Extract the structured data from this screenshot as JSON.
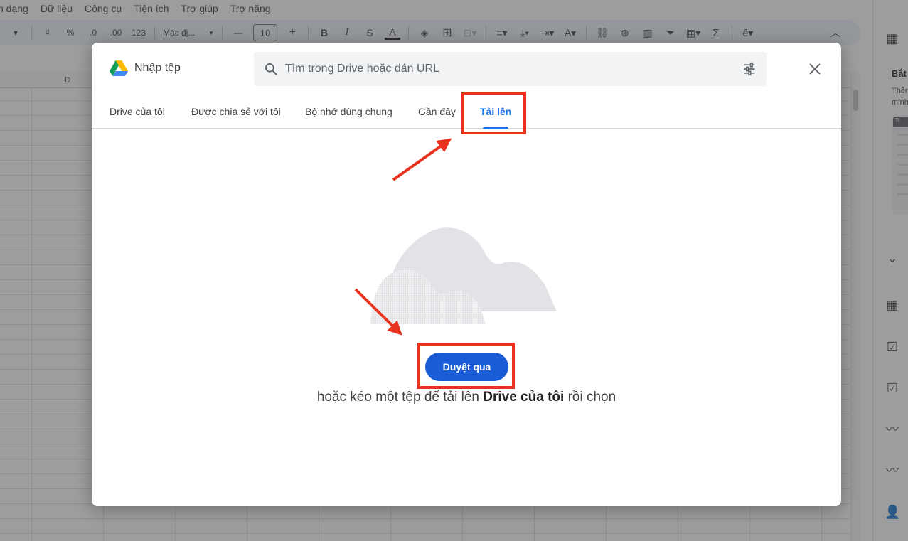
{
  "menubar": [
    "n dạng",
    "Dữ liệu",
    "Công cụ",
    "Tiện ích",
    "Trợ giúp",
    "Trợ năng"
  ],
  "toolbar": {
    "currency": "₫",
    "percent": "%",
    "dec_decrease": ".0",
    "dec_increase": ".00",
    "number_format": "123",
    "font": "Mặc đị...",
    "font_size": "10"
  },
  "sheet": {
    "column_label": "D"
  },
  "side_panel": {
    "heading": "Bắt",
    "line1": "Thêr",
    "line2": "minh",
    "card_tab": "Tr"
  },
  "dialog": {
    "title": "Nhập tệp",
    "search_placeholder": "Tìm trong Drive hoặc dán URL",
    "tabs": [
      {
        "label": "Drive của tôi",
        "active": false
      },
      {
        "label": "Được chia sẻ với tôi",
        "active": false
      },
      {
        "label": "Bộ nhớ dùng chung",
        "active": false
      },
      {
        "label": "Gần đây",
        "active": false
      },
      {
        "label": "Tải lên",
        "active": true
      }
    ],
    "browse_label": "Duyệt qua",
    "hint_prefix": "hoặc kéo một tệp để tải lên ",
    "hint_bold": "Drive của tôi",
    "hint_suffix": " rồi chọn"
  },
  "colors": {
    "accent": "#1a73e8",
    "button": "#1a5bd6",
    "highlight": "#e8321e"
  }
}
